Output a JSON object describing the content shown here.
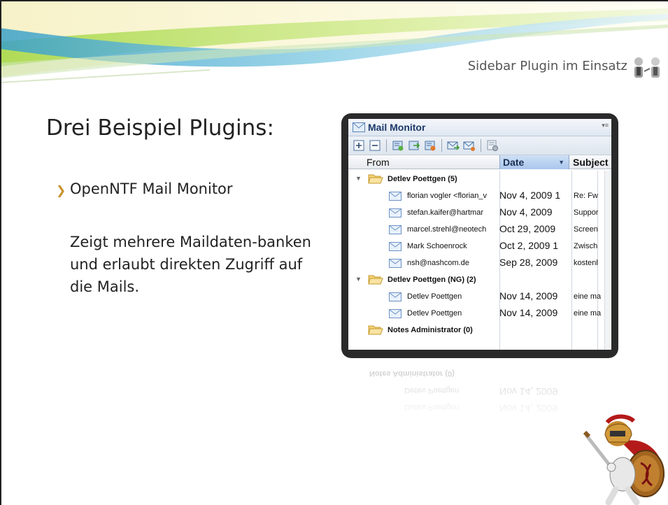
{
  "header": {
    "title": "Sidebar Plugin im Einsatz",
    "icon": "people-icon"
  },
  "slide": {
    "heading": "Drei Beispiel Plugins:",
    "bullet": "OpenNTF Mail Monitor",
    "description": "Zeigt mehrere Maildaten-banken und erlaubt direkten Zugriff auf die Mails."
  },
  "mail_monitor": {
    "title": "Mail Monitor",
    "columns": {
      "from": "From",
      "date": "Date",
      "subject": "Subject"
    },
    "groups": [
      {
        "label": "Detlev Poettgen (5)",
        "rows": [
          {
            "from": "florian vogler <florian_v",
            "date": "Nov 4, 2009 1",
            "subject": "Re: Fw"
          },
          {
            "from": "stefan.kaifer@hartmar",
            "date": "Nov 4, 2009",
            "subject": "Suppor"
          },
          {
            "from": "marcel.strehl@neotech",
            "date": "Oct 29, 2009",
            "subject": "Screen"
          },
          {
            "from": "Mark Schoenrock",
            "date": "Oct 2, 2009 1",
            "subject": "Zwisch"
          },
          {
            "from": "nsh@nashcom.de",
            "date": "Sep 28, 2009",
            "subject": "kostenl"
          }
        ]
      },
      {
        "label": "Detlev Poettgen (NG) (2)",
        "rows": [
          {
            "from": "Detlev Poettgen",
            "date": "Nov 14, 2009",
            "subject": "eine ma"
          },
          {
            "from": "Detlev Poettgen",
            "date": "Nov 14, 2009",
            "subject": "eine ma"
          }
        ]
      },
      {
        "label": "Notes Administrator (0)",
        "rows": []
      }
    ]
  },
  "colors": {
    "accent": "#c8922e",
    "window_frame": "#2a2a2a",
    "header_blue": "#1d3a6a",
    "swoosh_green": "#8fc63c"
  }
}
